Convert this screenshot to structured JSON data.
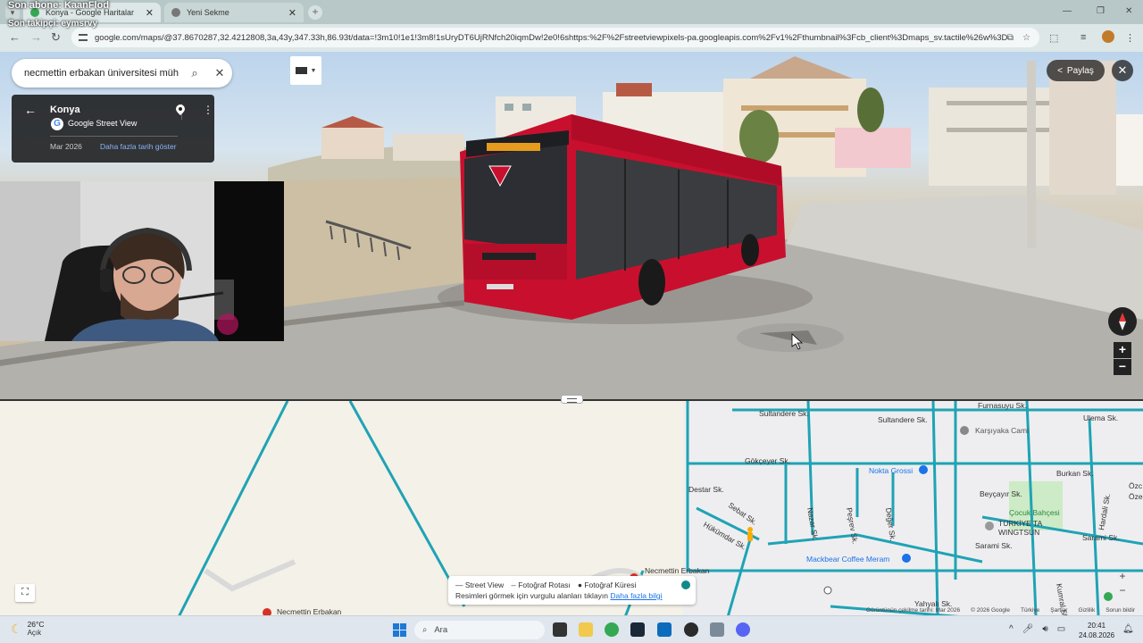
{
  "overlay": {
    "last_sub": "Son abone: KaanFlod",
    "last_follower": "Son takipçi: eymsrvy"
  },
  "browser": {
    "tabs": [
      {
        "label": "Konya - Google Haritalar",
        "icon": "google-maps-favicon"
      },
      {
        "label": "Yeni Sekme",
        "icon": "chrome-favicon"
      }
    ],
    "url": "google.com/maps/@37.8670287,32.4212808,3a,43y,347.33h,86.93t/data=!3m10!1e1!3m8!1sUryDT6UjRNfch20iqmDw!2e0!6shttps:%2F%2Fstreetviewpixels-pa.googleapis.com%2Fv1%2Fthumbnail%3Fcb_client%3Dmaps_sv.tactile%26w%3D90..."
  },
  "streetview": {
    "search_query": "necmettin erbakan üniversitesi müh",
    "card": {
      "place": "Konya",
      "source": "Google Street View",
      "date": "Mar 2026",
      "more_dates": "Daha fazla tarih göster"
    },
    "share_label": "Paylaş",
    "zoom_in": "+",
    "zoom_out": "−"
  },
  "map": {
    "streets": [
      "Sultandere Sk.",
      "Sultandere Sk.",
      "Furnasuyu Sk.",
      "Ulema Sk.",
      "Gökçeyer Sk.",
      "Nokta Grossi",
      "Burkan Sk.",
      "Beyçayır Sk.",
      "Destar Sk.",
      "Nazar Sk.",
      "Peşrev Sk.",
      "Değer Sk.",
      "Sebat Sk.",
      "Hükümdar Sk.",
      "Çocuk Bahçesi",
      "TÜRKİYE TA",
      "WINGTSUN",
      "Sarami Sk.",
      "Sarami Sk.",
      "Hardali Sk.",
      "Kumral Sk.",
      "Yahyalı Sk.",
      "Özc",
      "Öze",
      "Karşıyaka Cami",
      "Mackbear Coffee Meram",
      "Necmettin Erbakan",
      "Necmettin Erbakan"
    ],
    "legend": {
      "street_view": "Street View",
      "photo_route": "Fotoğraf Rotası",
      "photo_sphere": "Fotoğraf Küresi",
      "hint": "Resimleri görmek için vurgulu alanları tıklayın",
      "learn_more": "Daha fazla bilgi"
    },
    "footer": [
      "Görüntünün çekilme tarihi: Mar 2026",
      "© 2026 Google",
      "Türkiye",
      "Şartlar",
      "Gizlilik",
      "Sorun bildir"
    ],
    "zoom_in": "+",
    "zoom_out": "−"
  },
  "taskbar": {
    "temperature": "26°C",
    "condition": "Açık",
    "search_placeholder": "Ara",
    "time": "20:41",
    "date": "24.08.2026"
  },
  "colors": {
    "route_teal": "#1fa3b5",
    "bus_red": "#c8102e",
    "accent_blue": "#1a73e8"
  }
}
